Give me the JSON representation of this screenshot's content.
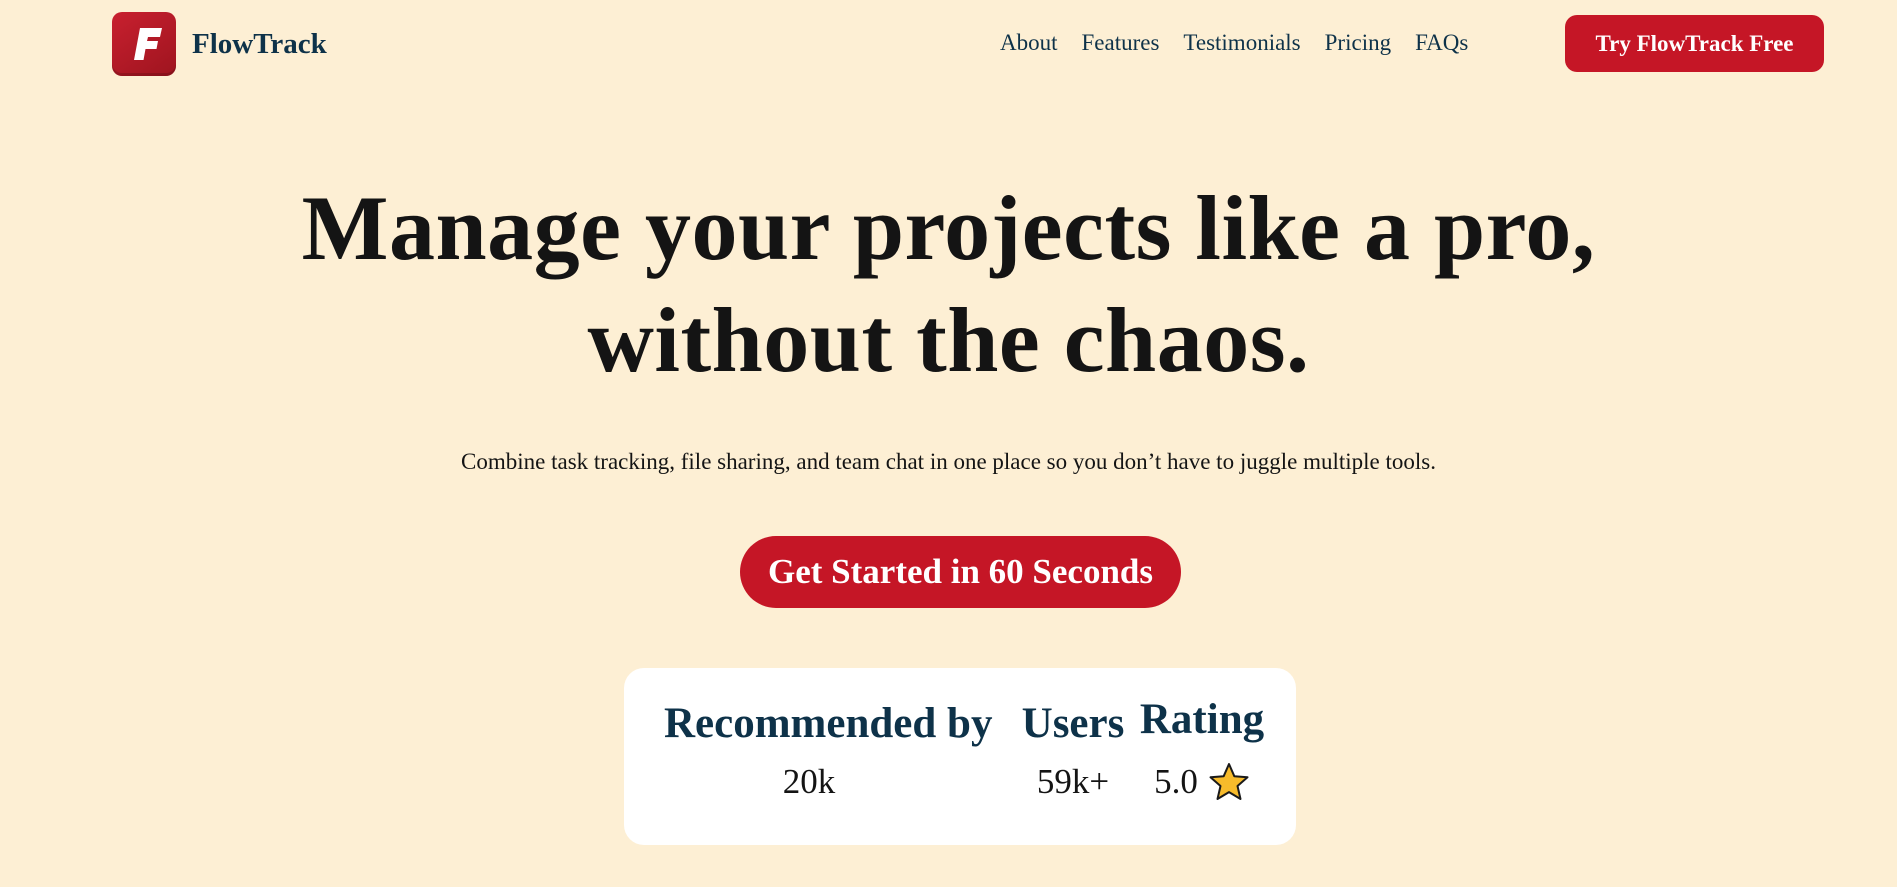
{
  "header": {
    "brand": "FlowTrack",
    "logo_letter": "F",
    "nav": [
      {
        "label": "About"
      },
      {
        "label": "Features"
      },
      {
        "label": "Testimonials"
      },
      {
        "label": "Pricing"
      },
      {
        "label": "FAQs"
      }
    ],
    "cta_label": "Try FlowTrack Free"
  },
  "hero": {
    "title_line1": "Manage your projects like a pro,",
    "title_line2": "without the chaos.",
    "subtitle": "Combine task tracking, file sharing, and team chat in one place so you don’t have to juggle multiple tools.",
    "cta_label": "Get Started in 60 Seconds"
  },
  "stats": [
    {
      "label": "Recommended by",
      "value": "20k"
    },
    {
      "label": "Users",
      "value": "59k+"
    },
    {
      "label": "Rating",
      "value": "5.0",
      "icon": "star-icon"
    }
  ],
  "colors": {
    "background": "#fdefd4",
    "brand_red": "#c51626",
    "navy": "#0e3249",
    "text": "#141414",
    "card": "#ffffff",
    "star": "#f7bb2b"
  }
}
